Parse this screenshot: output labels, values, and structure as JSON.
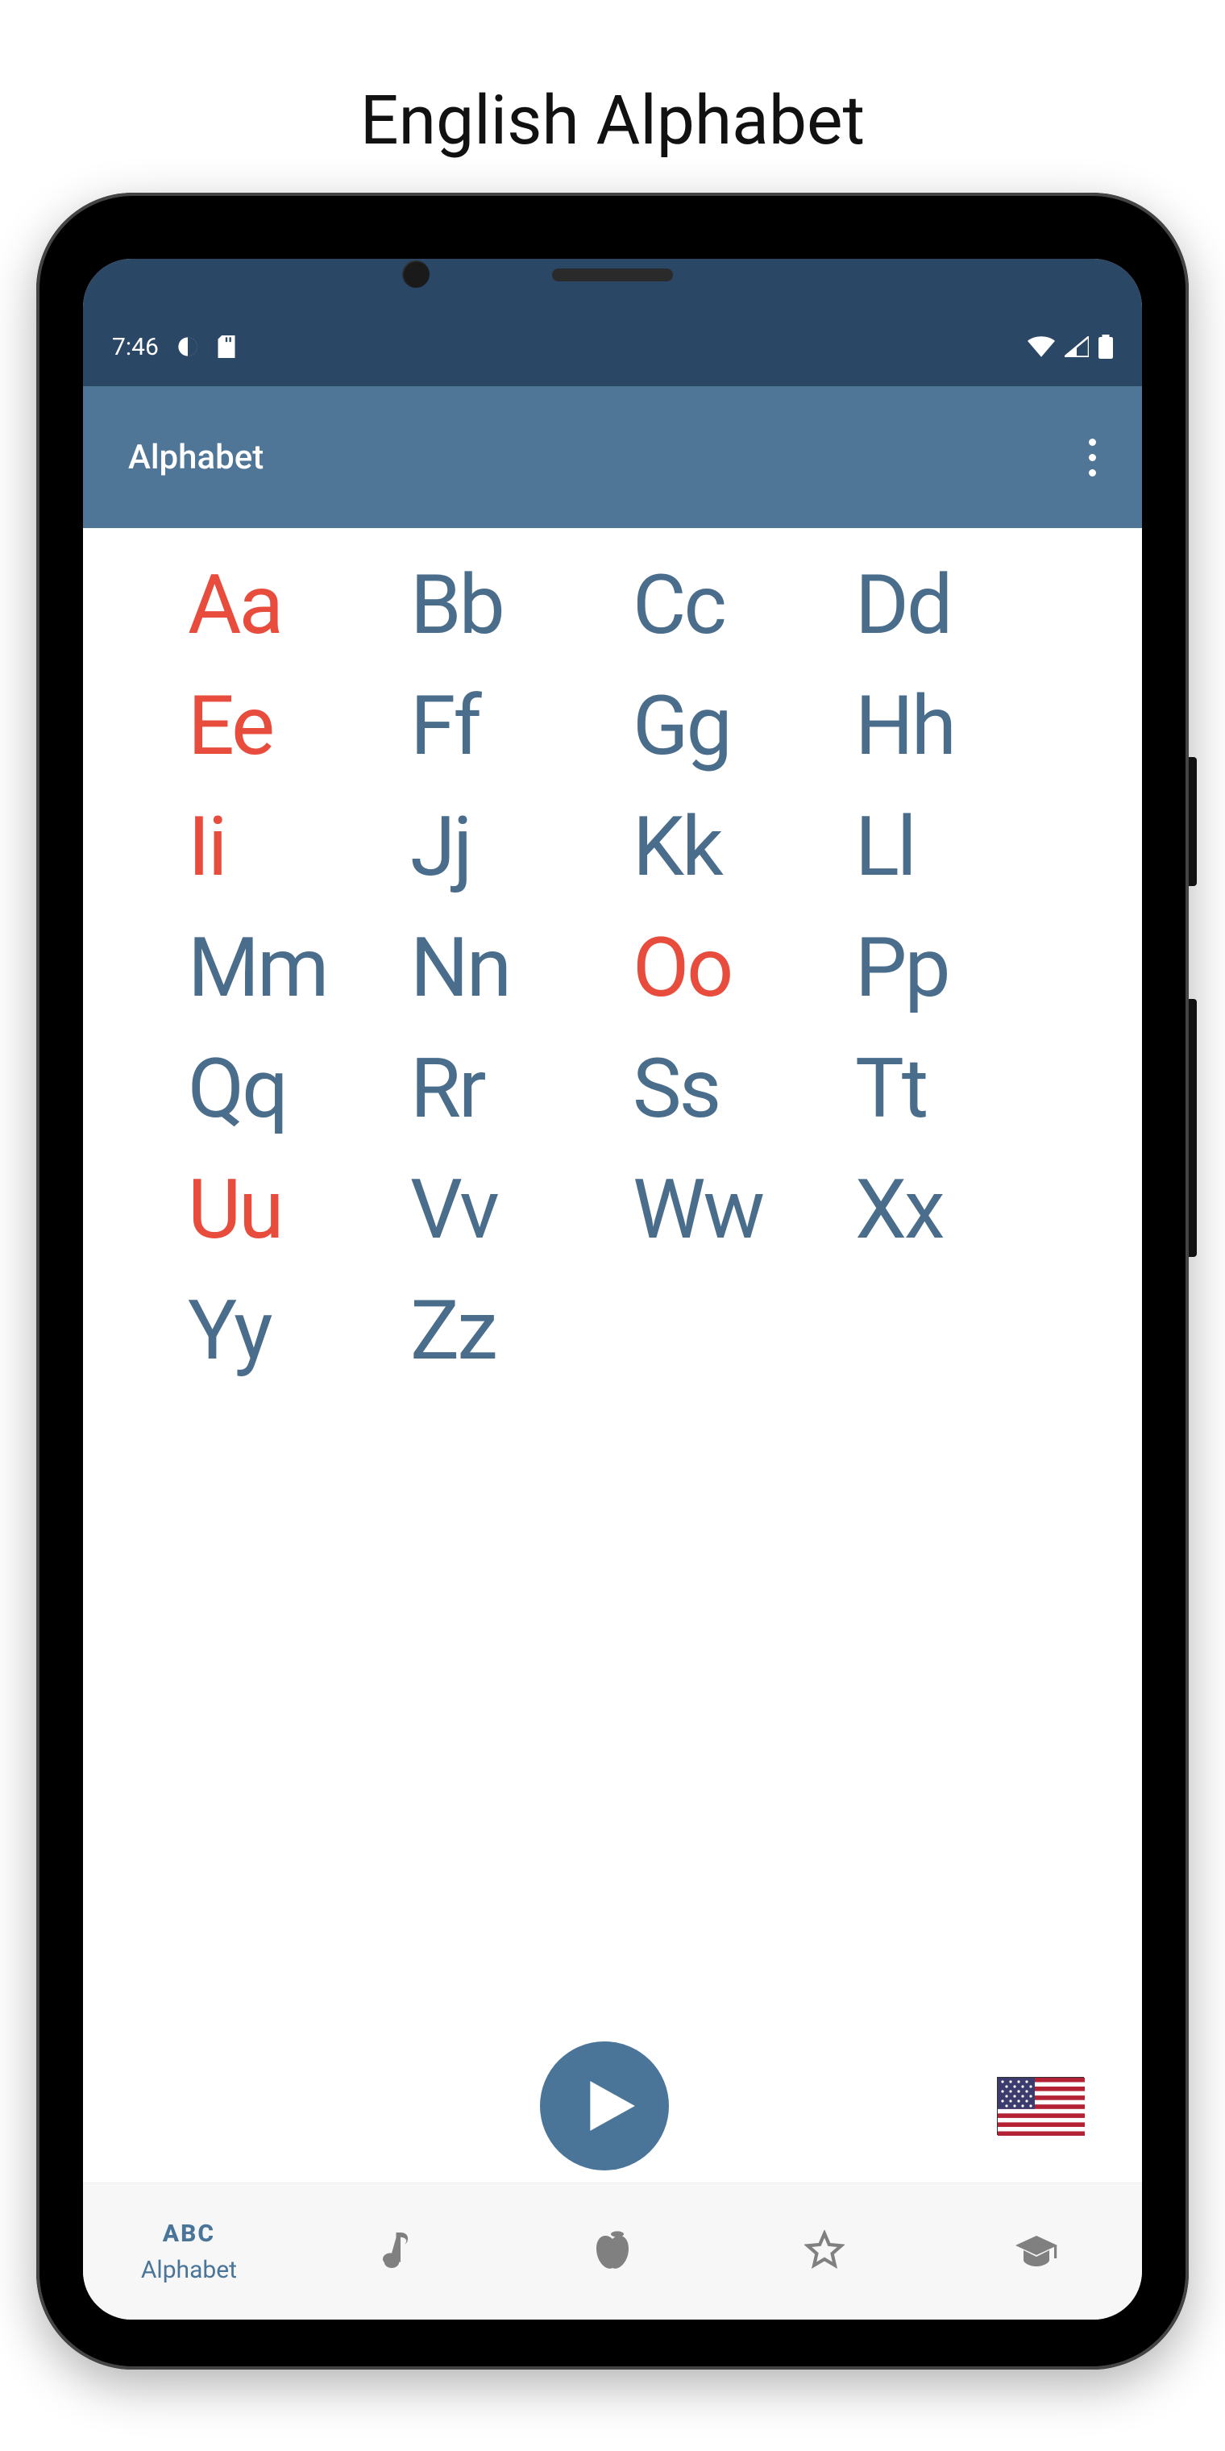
{
  "page_title": "English Alphabet",
  "status_bar": {
    "time": "7:46"
  },
  "app_bar": {
    "title": "Alphabet"
  },
  "alphabet": {
    "vowels": [
      "A",
      "E",
      "I",
      "O",
      "U"
    ],
    "letters": [
      {
        "upper": "A",
        "lower": "a"
      },
      {
        "upper": "B",
        "lower": "b"
      },
      {
        "upper": "C",
        "lower": "c"
      },
      {
        "upper": "D",
        "lower": "d"
      },
      {
        "upper": "E",
        "lower": "e"
      },
      {
        "upper": "F",
        "lower": "f"
      },
      {
        "upper": "G",
        "lower": "g"
      },
      {
        "upper": "H",
        "lower": "h"
      },
      {
        "upper": "I",
        "lower": "i"
      },
      {
        "upper": "J",
        "lower": "j"
      },
      {
        "upper": "K",
        "lower": "k"
      },
      {
        "upper": "L",
        "lower": "l"
      },
      {
        "upper": "M",
        "lower": "m"
      },
      {
        "upper": "N",
        "lower": "n"
      },
      {
        "upper": "O",
        "lower": "o"
      },
      {
        "upper": "P",
        "lower": "p"
      },
      {
        "upper": "Q",
        "lower": "q"
      },
      {
        "upper": "R",
        "lower": "r"
      },
      {
        "upper": "S",
        "lower": "s"
      },
      {
        "upper": "T",
        "lower": "t"
      },
      {
        "upper": "U",
        "lower": "u"
      },
      {
        "upper": "V",
        "lower": "v"
      },
      {
        "upper": "W",
        "lower": "w"
      },
      {
        "upper": "X",
        "lower": "x"
      },
      {
        "upper": "Y",
        "lower": "y"
      },
      {
        "upper": "Z",
        "lower": "z"
      }
    ]
  },
  "flag": "us",
  "colors": {
    "vowel": "#e74c3c",
    "consonant": "#4a6d8c",
    "status_bar": "#2a4766",
    "app_bar": "#507697"
  },
  "bottom_nav": {
    "active_index": 0,
    "items": [
      {
        "id": "alphabet",
        "label": "Alphabet",
        "abc": "ABC"
      },
      {
        "id": "music",
        "label": ""
      },
      {
        "id": "food",
        "label": ""
      },
      {
        "id": "favorites",
        "label": ""
      },
      {
        "id": "learn",
        "label": ""
      }
    ]
  }
}
